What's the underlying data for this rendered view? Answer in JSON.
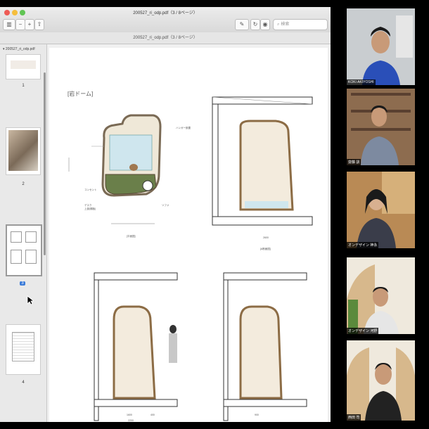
{
  "viewer": {
    "window_title": "200527_ri_odp.pdf（3 / 8ページ）",
    "doc_title": "200527_ri_odp.pdf（3 / 8ページ）",
    "search_placeholder": "検索",
    "toolbar": {
      "sidebar_icon": "sidebar-icon",
      "zoom_out_icon": "zoom-out-icon",
      "zoom_in_icon": "zoom-in-icon",
      "share_icon": "share-icon",
      "markup_icon": "pen-icon",
      "rotate_icon": "rotate-icon",
      "annotate_icon": "markup-icon"
    }
  },
  "sidebar": {
    "file_label": "▾ 200527_ri_odp.pdf",
    "pages": [
      {
        "number": "1"
      },
      {
        "number": "2"
      },
      {
        "number": "3",
        "selected": true
      },
      {
        "number": "4"
      }
    ]
  },
  "page": {
    "heading": "[岩ドーム]",
    "labels": {
      "hanger": "ハンガー設置",
      "outlet": "コンセント",
      "desk": "デスク\n上部(棚板)",
      "sofa": "ソファ",
      "plan": "[平面図]",
      "section_a": "[A断面図]",
      "dim_a": "2600",
      "dim_b": "1600",
      "dim_c": "900",
      "dim_d": "400",
      "dim_e": "2200"
    }
  },
  "participants": [
    {
      "name": "KOKI AKIYOSHI",
      "active": false,
      "shirt": "#2a4fb8"
    },
    {
      "name": "齋藤 訓",
      "active": false,
      "shirt": "#7d8aa0"
    },
    {
      "name": "オンデザイン 神永",
      "active": true,
      "shirt": "#3a3d4a"
    },
    {
      "name": "オンデザイン 河野",
      "active": false,
      "shirt": "#e6e6e6"
    },
    {
      "name": "西田 司",
      "active": false,
      "shirt": "#222"
    }
  ]
}
